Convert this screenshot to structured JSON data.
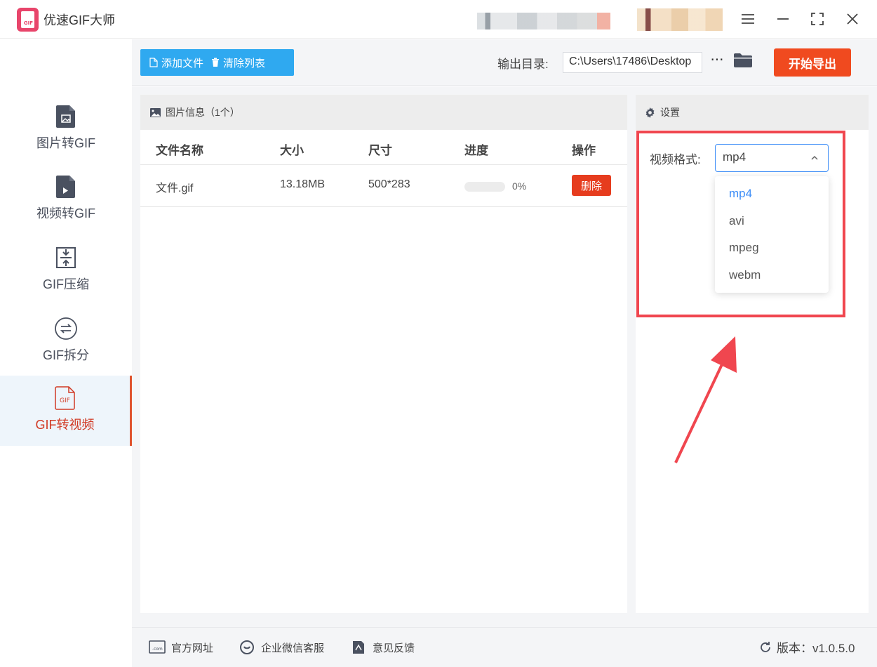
{
  "app": {
    "title": "优速GIF大师",
    "logo_text": "GIF"
  },
  "window_controls": {
    "menu": "hamburger-menu-icon",
    "minimize": "minimize-icon",
    "maximize": "maximize-icon",
    "close": "close-icon"
  },
  "sidebar": {
    "items": [
      {
        "label": "图片转GIF",
        "icon": "image-file-icon",
        "active": false
      },
      {
        "label": "视频转GIF",
        "icon": "video-file-icon",
        "active": false
      },
      {
        "label": "GIF压缩",
        "icon": "compress-icon",
        "active": false
      },
      {
        "label": "GIF拆分",
        "icon": "split-icon",
        "active": false
      },
      {
        "label": "GIF转视频",
        "icon": "gif-file-icon",
        "active": true
      }
    ]
  },
  "toolbar": {
    "add_file": "添加文件",
    "clear_list": "清除列表",
    "output_label": "输出目录:",
    "output_path": "C:\\Users\\17486\\Desktop",
    "more": "···",
    "export": "开始导出"
  },
  "file_panel": {
    "header": "图片信息（1个）",
    "columns": [
      "文件名称",
      "大小",
      "尺寸",
      "进度",
      "操作"
    ],
    "rows": [
      {
        "name": "文件.gif",
        "size": "13.18MB",
        "dimensions": "500*283",
        "progress": 0,
        "progress_text": "0%",
        "action": "删除"
      }
    ]
  },
  "settings": {
    "header": "设置",
    "format_label": "视频格式:",
    "format_value": "mp4",
    "options": [
      "mp4",
      "avi",
      "mpeg",
      "webm"
    ]
  },
  "colors": {
    "accent_blue": "#2fa9f0",
    "export_red": "#f04a1f",
    "highlight": "#f0464f",
    "select_blue": "#3e8ef7"
  },
  "footer": {
    "website": "官方网址",
    "wechat": "企业微信客服",
    "feedback": "意见反馈",
    "version": "版本：v1.0.5.0"
  }
}
